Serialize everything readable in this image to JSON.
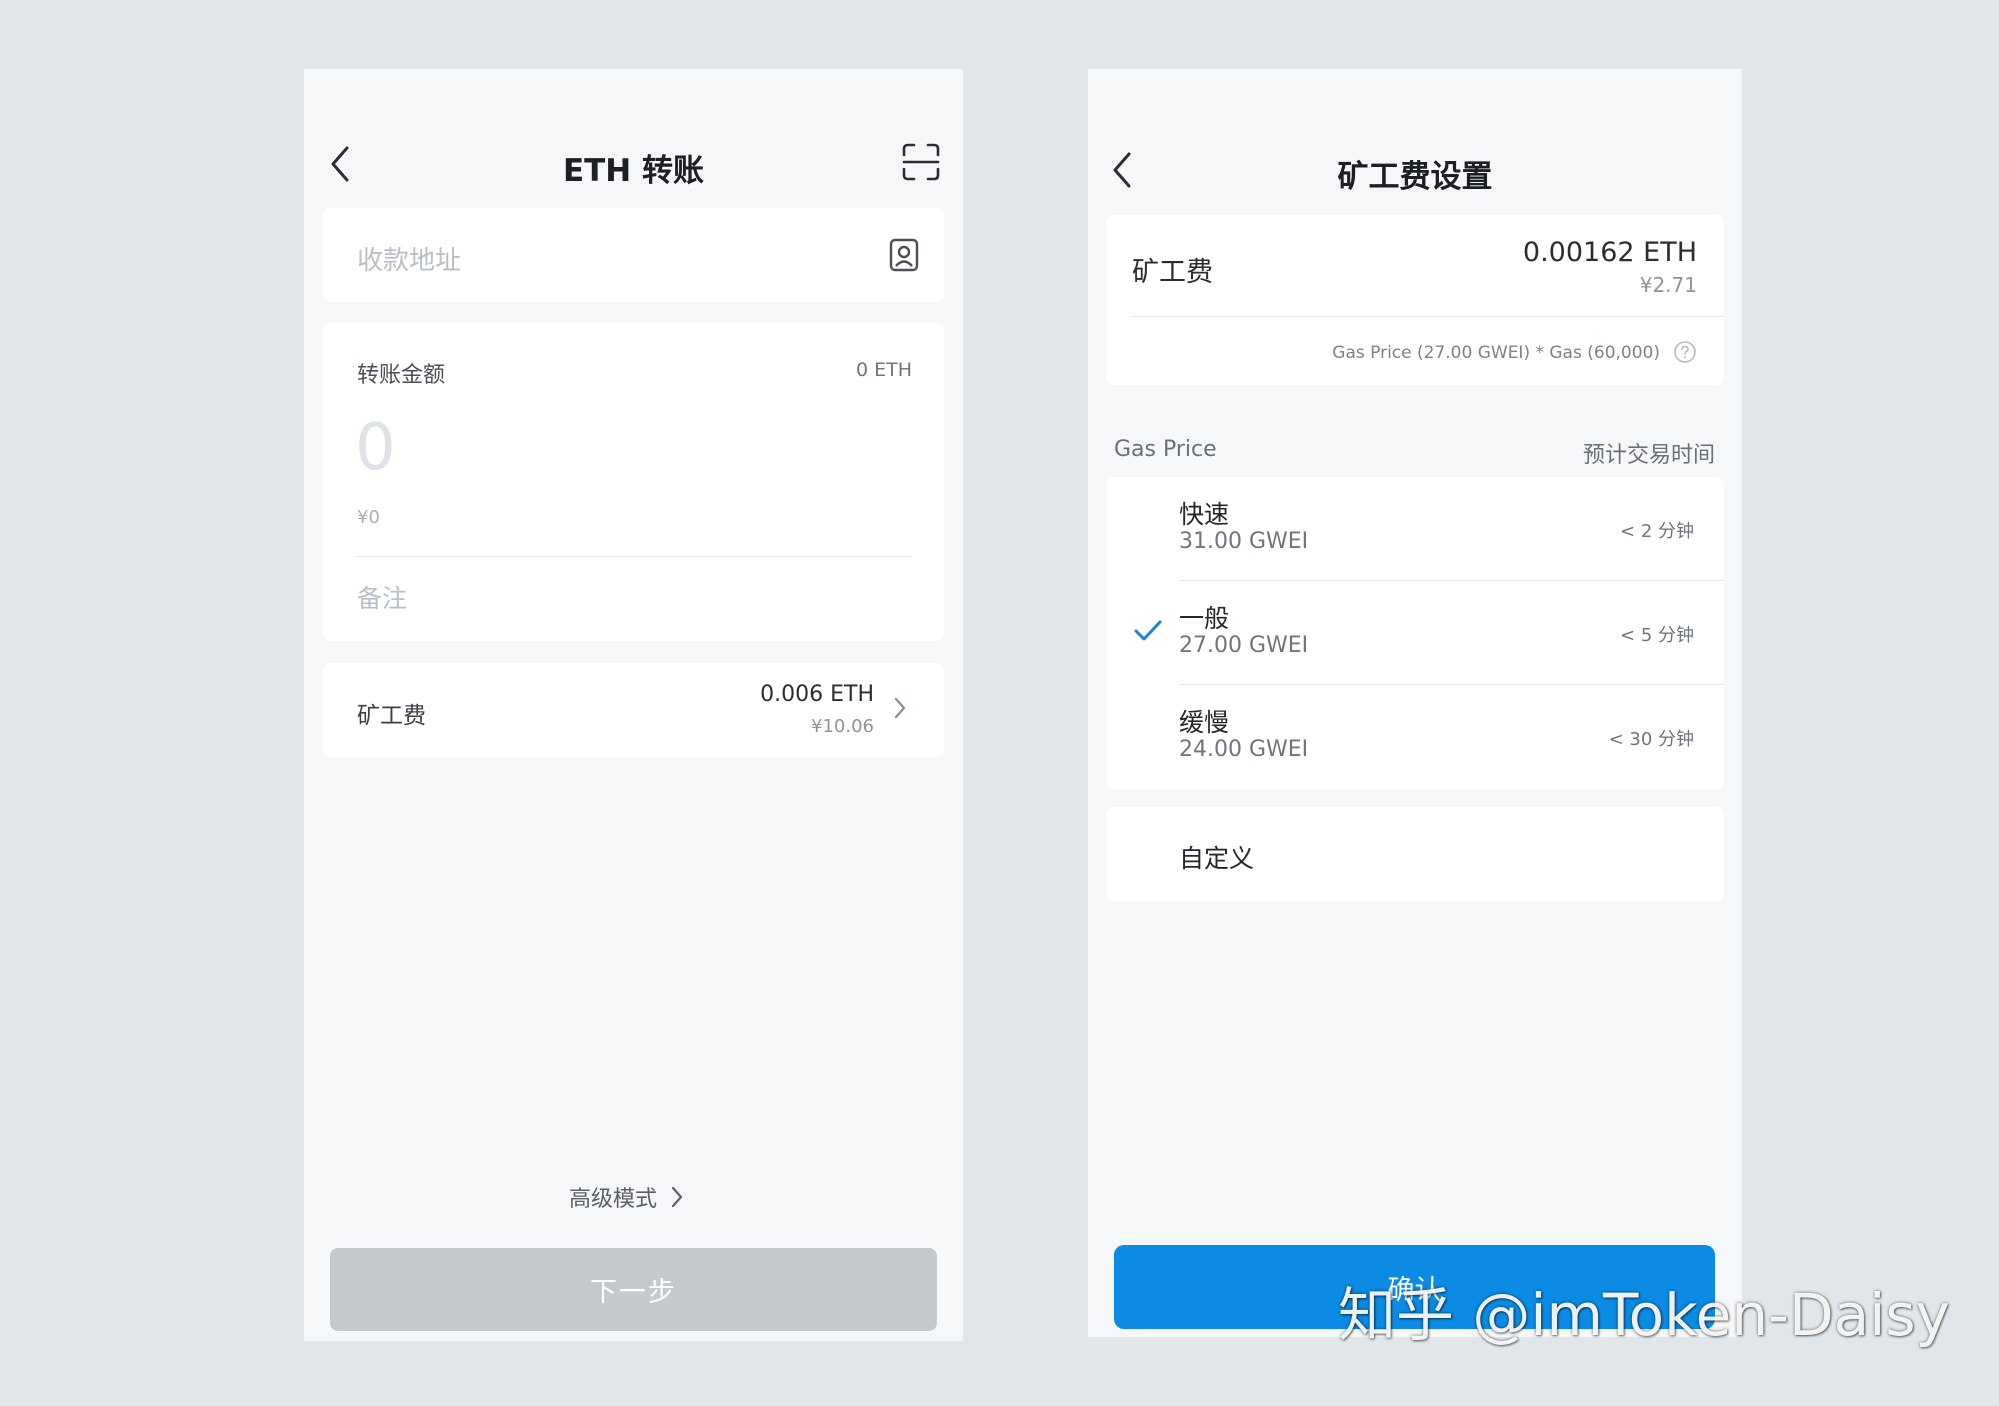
{
  "transfer": {
    "title": "ETH 转账",
    "address_placeholder": "收款地址",
    "amount_label": "转账金额",
    "balance": "0 ETH",
    "amount_placeholder": "0",
    "amount_fiat": "¥0",
    "memo_placeholder": "备注",
    "fee_label": "矿工费",
    "fee_eth": "0.006 ETH",
    "fee_fiat": "¥10.06",
    "advanced_mode": "高级模式",
    "next_button": "下一步"
  },
  "fee_settings": {
    "title": "矿工费设置",
    "fee_label": "矿工费",
    "fee_eth": "0.00162 ETH",
    "fee_fiat": "¥2.71",
    "formula": "Gas Price (27.00 GWEI) * Gas (60,000)",
    "gas_price_header": "Gas Price",
    "eta_header": "预计交易时间",
    "options": [
      {
        "name": "快速",
        "gwei": "31.00 GWEI",
        "time": "< 2 分钟",
        "selected": false
      },
      {
        "name": "一般",
        "gwei": "27.00 GWEI",
        "time": "< 5 分钟",
        "selected": true
      },
      {
        "name": "缓慢",
        "gwei": "24.00 GWEI",
        "time": "< 30 分钟",
        "selected": false
      }
    ],
    "custom_label": "自定义",
    "confirm_button": "确认"
  },
  "watermark": "知乎 @imToken-Daisy",
  "colors": {
    "background": "#e1e6ea",
    "screen": "#f5f7f9",
    "card": "#ffffff",
    "accent": "#0b8be4",
    "disabled_button": "#c4c9ce"
  }
}
